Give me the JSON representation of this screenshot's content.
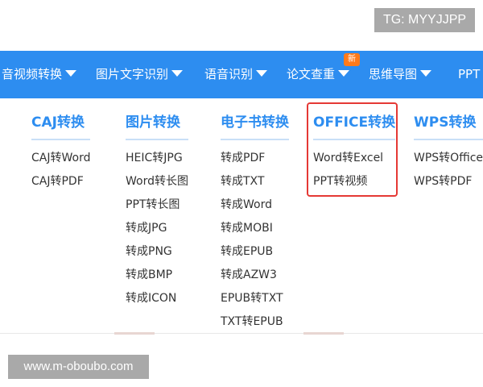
{
  "overlay": {
    "tg_label": "TG: MYYJJPP",
    "watermark": "www.m-oboubo.com"
  },
  "nav": {
    "items": [
      {
        "label": "音视频转换"
      },
      {
        "label": "图片文字识别"
      },
      {
        "label": "语音识别"
      },
      {
        "label": "论文查重"
      },
      {
        "label": "思维导图"
      },
      {
        "label": "PPT"
      }
    ],
    "new_badge": "新",
    "background": "#2d8df0",
    "badge_color": "#ff7a1a"
  },
  "menu": {
    "columns": [
      {
        "title": "CAJ转换",
        "links": [
          "CAJ转Word",
          "CAJ转PDF"
        ]
      },
      {
        "title": "图片转换",
        "links": [
          "HEIC转JPG",
          "Word转长图",
          "PPT转长图",
          "转成JPG",
          "转成PNG",
          "转成BMP",
          "转成ICON"
        ]
      },
      {
        "title": "电子书转换",
        "links": [
          "转成PDF",
          "转成TXT",
          "转成Word",
          "转成MOBI",
          "转成EPUB",
          "转成AZW3",
          "EPUB转TXT",
          "TXT转EPUB"
        ]
      },
      {
        "title": "OFFICE转换",
        "links": [
          "Word转Excel",
          "PPT转视频"
        ]
      },
      {
        "title": "WPS转换",
        "links": [
          "WPS转Office",
          "WPS转PDF"
        ]
      }
    ],
    "title_color": "#2d8df0",
    "highlight_color": "#e53935"
  }
}
